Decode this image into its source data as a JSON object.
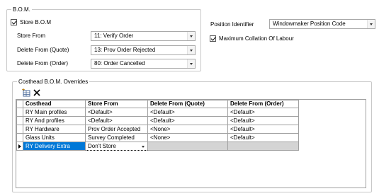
{
  "bom": {
    "legend": "B.O.M.",
    "store_bom": {
      "label": "Store B.O.M",
      "checked": true
    },
    "fields": [
      {
        "label": "Store From",
        "value": "11: Verify Order"
      },
      {
        "label": "Delete From (Quote)",
        "value": "13: Prov Order Rejected"
      },
      {
        "label": "Delete From (Order)",
        "value": "80: Order Cancelled"
      }
    ]
  },
  "position": {
    "label": "Position Identifier",
    "value": "Windowmaker Position Code",
    "max_collation": {
      "label": "Maximum Collation Of Labour",
      "checked": true
    }
  },
  "overrides": {
    "legend": "Costhead B.O.M. Overrides",
    "toolbar": {
      "add_icon": "add-row-icon",
      "delete_icon": "delete-x-icon"
    },
    "columns": [
      "Costhead",
      "Store From",
      "Delete From (Quote)",
      "Delete From (Order)"
    ],
    "rows": [
      [
        "RY Main profiles",
        "<Default>",
        "<Default>",
        "<Default>"
      ],
      [
        "RY And profiles",
        "<Default>",
        "<Default>",
        "<Default>"
      ],
      [
        "RY Hardware",
        "Prov Order Accepted",
        "<None>",
        "<Default>"
      ],
      [
        "Glass Units",
        "Survey Completed",
        "<None>",
        "<Default>"
      ],
      [
        "RY Delivery Extra",
        "Don't Store",
        "",
        ""
      ]
    ],
    "selected_row": 4
  }
}
